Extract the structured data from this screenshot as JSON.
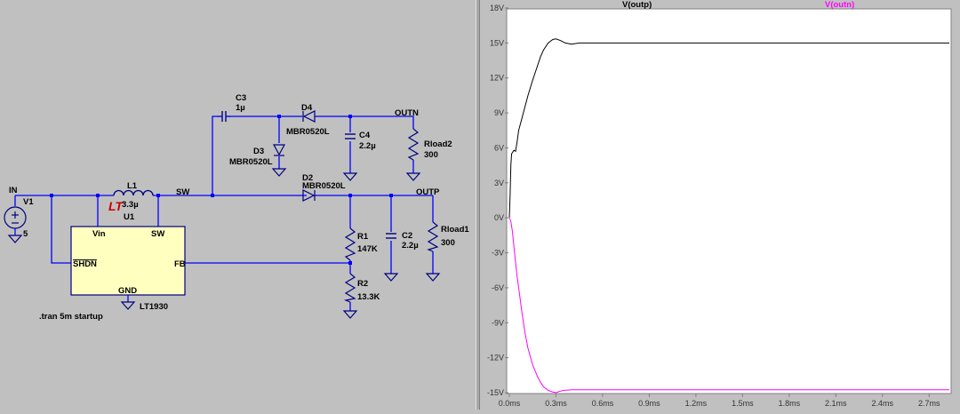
{
  "schematic": {
    "net_labels": {
      "in": "IN",
      "sw": "SW",
      "outn": "OUTN",
      "outp": "OUTP"
    },
    "components": {
      "v1": {
        "name": "V1",
        "value": "5"
      },
      "l1": {
        "name": "L1",
        "value": "3.3µ"
      },
      "u1": {
        "name": "U1",
        "part": "LT1930",
        "pins": {
          "vin": "Vin",
          "sw": "SW",
          "shdn": "SHDN",
          "fb": "FB",
          "gnd": "GND"
        },
        "logo": "LT"
      },
      "c3": {
        "name": "C3",
        "value": "1µ"
      },
      "d4": {
        "name": "D4",
        "value": "MBR0520L"
      },
      "d3": {
        "name": "D3",
        "value": "MBR0520L"
      },
      "c4": {
        "name": "C4",
        "value": "2.2µ"
      },
      "rload2": {
        "name": "Rload2",
        "value": "300"
      },
      "d2": {
        "name": "D2",
        "value": "MBR0520L"
      },
      "r1": {
        "name": "R1",
        "value": "147K"
      },
      "r2": {
        "name": "R2",
        "value": "13.3K"
      },
      "c2": {
        "name": "C2",
        "value": "2.2µ"
      },
      "rload1": {
        "name": "Rload1",
        "value": "300"
      }
    },
    "directive": ".tran 5m startup",
    "colors": {
      "wire": "#0000ff",
      "component": "#000080",
      "ic_fill": "#ffffc0",
      "logo": "#cc0000"
    }
  },
  "chart_data": {
    "type": "line",
    "xlabel": "",
    "ylabel": "",
    "x_ticks": [
      "0.0ms",
      "0.3ms",
      "0.6ms",
      "0.9ms",
      "1.2ms",
      "1.5ms",
      "1.8ms",
      "2.1ms",
      "2.4ms",
      "2.7ms"
    ],
    "y_ticks": [
      "18V",
      "15V",
      "12V",
      "9V",
      "6V",
      "3V",
      "0V",
      "-3V",
      "-6V",
      "-9V",
      "-12V",
      "-15V"
    ],
    "xlim": [
      0,
      2.83
    ],
    "ylim": [
      -15,
      18
    ],
    "grid": false,
    "legend": "top",
    "series": [
      {
        "name": "V(outp)",
        "color": "#000000",
        "x": [
          0,
          0.005,
          0.01,
          0.015,
          0.02,
          0.03,
          0.04,
          0.05,
          0.06,
          0.08,
          0.1,
          0.12,
          0.15,
          0.18,
          0.2,
          0.22,
          0.25,
          0.28,
          0.3,
          0.33,
          0.36,
          0.4,
          0.45,
          0.5,
          0.6,
          0.8,
          1.0,
          1.5,
          2.0,
          2.5,
          2.83
        ],
        "y": [
          0,
          2,
          4.5,
          5.5,
          5.6,
          5.8,
          5.7,
          6.5,
          7.5,
          8.5,
          9.5,
          10.5,
          11.8,
          13,
          13.8,
          14.4,
          15,
          15.3,
          15.35,
          15.2,
          15.0,
          14.9,
          15.0,
          15.0,
          15.0,
          15.0,
          15.0,
          15.0,
          15.0,
          15.0,
          15.0
        ]
      },
      {
        "name": "V(outn)",
        "color": "#ff00ff",
        "x": [
          0,
          0.01,
          0.02,
          0.03,
          0.04,
          0.05,
          0.06,
          0.08,
          0.1,
          0.12,
          0.15,
          0.18,
          0.2,
          0.22,
          0.25,
          0.28,
          0.3,
          0.32,
          0.35,
          0.4,
          0.5,
          0.6,
          0.8,
          1.0,
          1.5,
          2.0,
          2.5,
          2.83
        ],
        "y": [
          0,
          -0.3,
          -1.2,
          -2.5,
          -3.8,
          -5,
          -6,
          -8,
          -9.8,
          -11.2,
          -12.6,
          -13.6,
          -14.1,
          -14.5,
          -14.8,
          -14.95,
          -15.0,
          -14.9,
          -14.8,
          -14.75,
          -14.75,
          -14.75,
          -14.75,
          -14.75,
          -14.75,
          -14.75,
          -14.75,
          -14.75
        ]
      }
    ]
  }
}
